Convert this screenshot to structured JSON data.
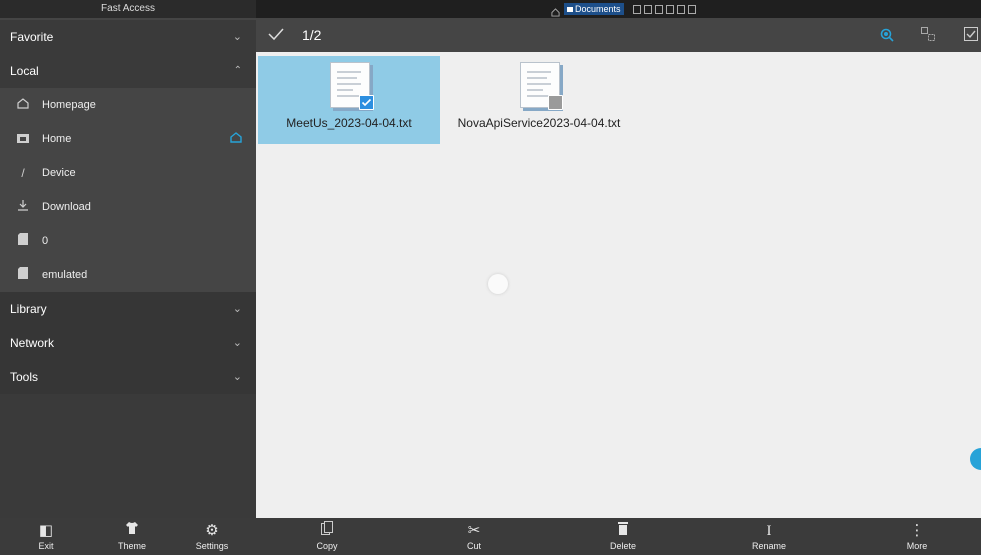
{
  "sidebar": {
    "header": "Fast Access",
    "sections": {
      "favorite": "Favorite",
      "local": "Local",
      "library": "Library",
      "network": "Network",
      "tools": "Tools"
    },
    "local_items": [
      {
        "label": "Homepage",
        "icon": "house-outline-icon"
      },
      {
        "label": "Home",
        "icon": "folder-icon"
      },
      {
        "label": "Device",
        "icon": "slash-icon"
      },
      {
        "label": "Download",
        "icon": "download-icon"
      },
      {
        "label": "0",
        "icon": "sd-card-icon"
      },
      {
        "label": "emulated",
        "icon": "sd-card-icon"
      }
    ]
  },
  "statusbar": {
    "tab_label": "Documents"
  },
  "toolbar": {
    "selection_count": "1/2"
  },
  "files": [
    {
      "name": "MeetUs_2023-04-04.txt",
      "selected": true
    },
    {
      "name": "NovaApiService2023-04-04.txt",
      "selected": false
    }
  ],
  "bottom_left": [
    {
      "label": "Exit",
      "icon": "exit-icon"
    },
    {
      "label": "Theme",
      "icon": "shirt-icon"
    },
    {
      "label": "Settings",
      "icon": "gear-icon"
    }
  ],
  "actions": [
    {
      "label": "Copy",
      "icon": "copy-icon"
    },
    {
      "label": "Cut",
      "icon": "scissors-icon"
    },
    {
      "label": "Delete",
      "icon": "trash-icon"
    },
    {
      "label": "Rename",
      "icon": "text-cursor-icon"
    },
    {
      "label": "More",
      "icon": "more-vertical-icon"
    }
  ],
  "colors": {
    "selection": "#8fcbe6",
    "accent": "#27a3d8",
    "sidebar": "#454545"
  }
}
